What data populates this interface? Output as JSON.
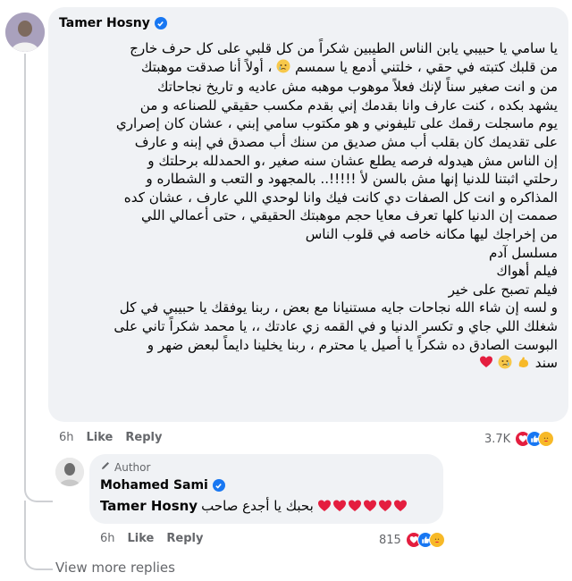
{
  "main_comment": {
    "author": "Tamer Hosny",
    "text_lines": [
      "يا سامي يا حبيبي يابن الناس الطيبين شكراً من كل قلبي على كل حرف خارج",
      "من قلبك كتبته في حقي ، خلتني أدمع يا سمسم",
      "، أولاً أنا صدقت موهبتك",
      "من و انت صغير سناً لإنك فعلاً موهوب موهبه مش عاديه و تاريخ نجاحاتك",
      "يشهد بكده ، كنت عارف وانا بقدمك إني بقدم مكسب حقيقي للصناعه و من",
      "يوم ماسجلت رقمك على تليفوني و هو مكتوب سامي إبني ، عشان كان إصراري",
      "على تقديمك كان بقلب أب مش صديق من سنك أب مصدق في إبنه و عارف",
      "إن الناس مش هيدوله فرصه يطلع عشان سنه صغير ،و الحمدلله برحلتك و",
      "رحلتي اثبتنا للدنيا إنها مش بالسن لأ !!!!!.. بالمجهود و التعب و الشطاره و",
      "المذاكره و انت كل الصفات دي كانت فيك وانا لوحدي اللي عارف ، عشان كده",
      "صممت إن الدنيا كلها تعرف معايا حجم موهبتك الحقيقي ، حتى أعمالي اللي",
      "من إخراجك ليها مكانه خاصه في قلوب الناس",
      "مسلسل آدم",
      "فيلم أهواك",
      "فيلم تصبح على خير",
      "و لسه إن شاء الله نجاحات جايه مستنيانا مع بعض ، ربنا يوفقك يا حبيبي في كل",
      "شغلك اللي جاي و تكسر الدنيا و في القمه زي عادتك ،، يا محمد شكراً تاني على",
      "البوست الصادق ده شكراً يا أصيل يا محترم ، ربنا يخلينا دايماً لبعض ضهر و",
      "سند"
    ],
    "time": "6h",
    "like_label": "Like",
    "reply_label": "Reply",
    "reaction_count": "3.7K"
  },
  "reply_comment": {
    "badge": "Author",
    "author": "Mohamed Sami",
    "text_prefix": "بحبك يا أجدع صاحب",
    "text_mention": "Tamer Hosny",
    "time": "6h",
    "like_label": "Like",
    "reply_label": "Reply",
    "reaction_count": "815"
  },
  "view_more_label": "View more replies",
  "colors": {
    "bubble": "#f0f2f5",
    "meta_text": "#65676b",
    "verified": "#1877f2",
    "heart": "#e41e3f",
    "like_blue": "#1877f2",
    "haha_yellow": "#f7b928"
  },
  "icons": [
    "verified-icon",
    "heart-emoji",
    "crying-face-emoji",
    "muscle-emoji",
    "pen-icon",
    "heart-reaction-icon",
    "like-reaction-icon",
    "care-reaction-icon"
  ]
}
